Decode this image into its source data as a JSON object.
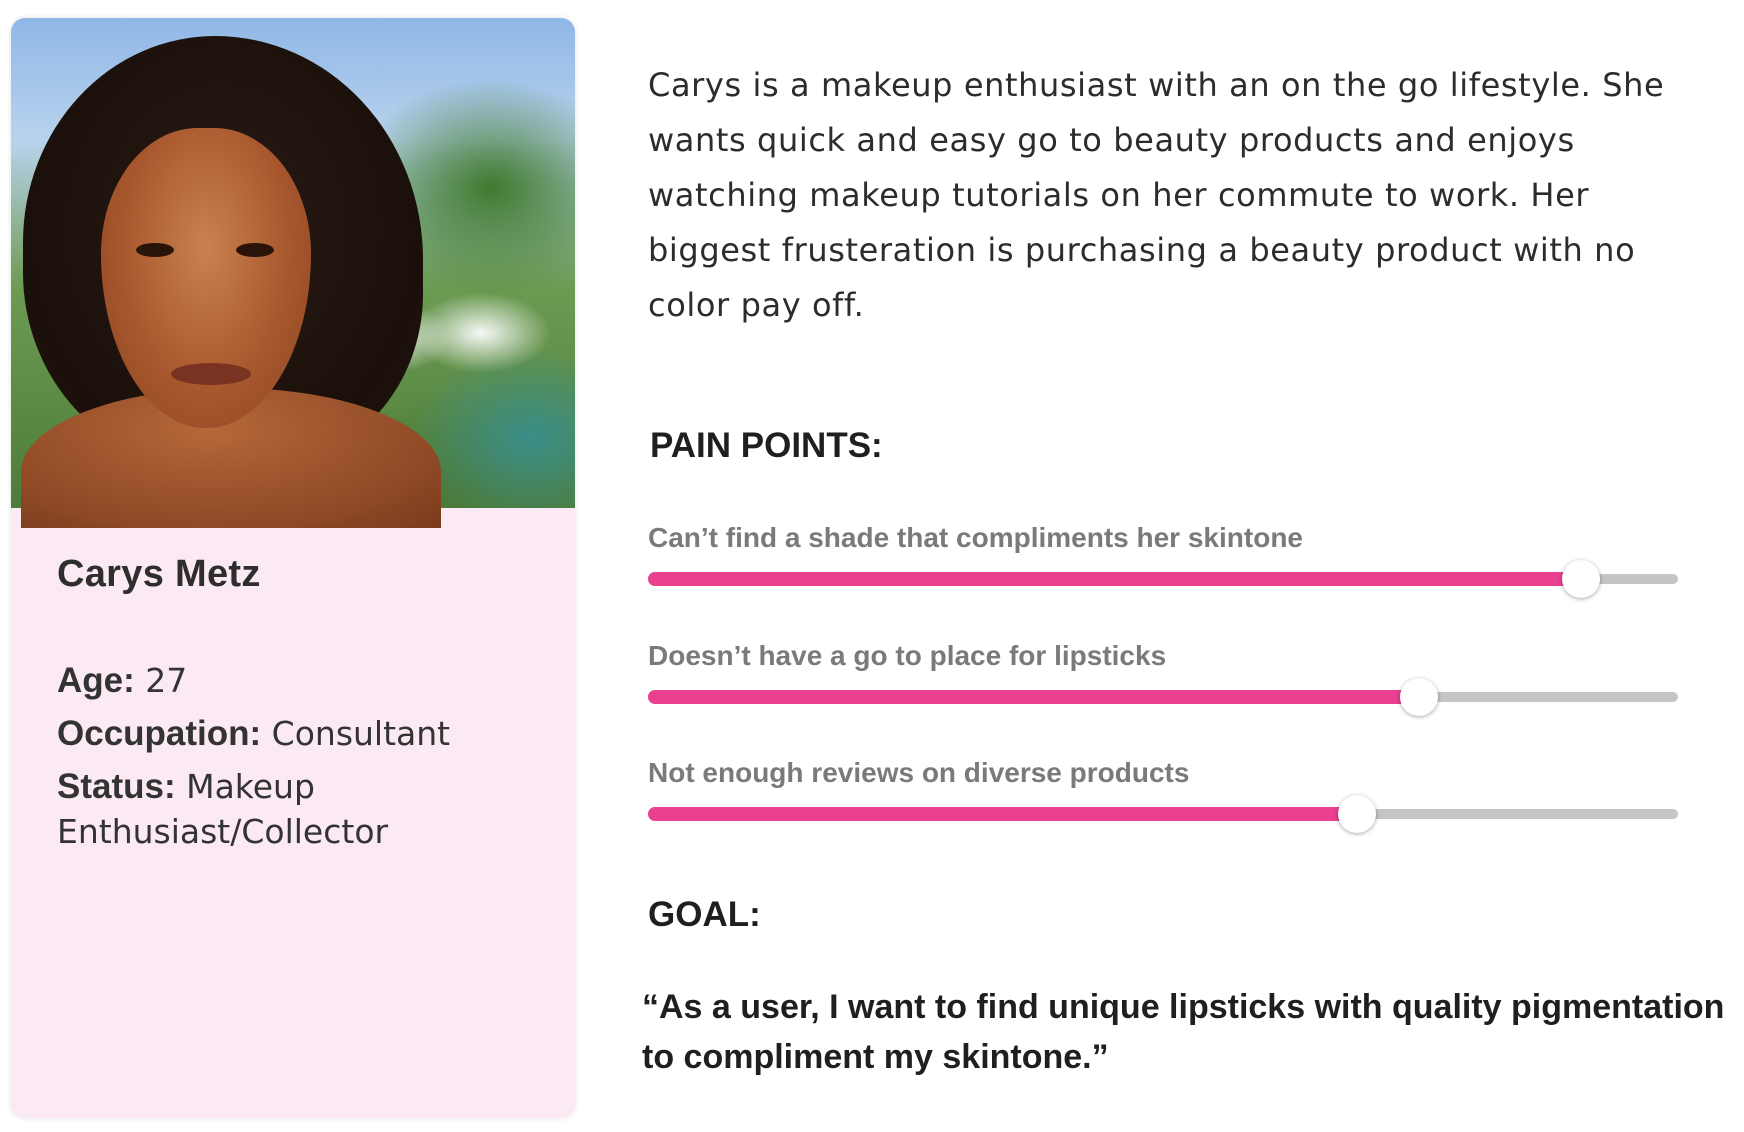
{
  "persona": {
    "name": "Carys Metz",
    "details": [
      {
        "label": "Age:",
        "value": " 27"
      },
      {
        "label": "Occupation:",
        "value": " Consultant"
      },
      {
        "label": "Status:",
        "value": " Makeup Enthusiast/Collector"
      }
    ]
  },
  "bio": "Carys is a makeup enthusiast with an on the go lifestyle. She wants quick and easy go to beauty products and enjoys watching makeup tutorials on her commute to work. Her biggest frusteration is purchasing a beauty product with no color pay off.",
  "pain_points": {
    "heading": "PAIN POINTS:",
    "items": [
      {
        "label": "Can’t find a shade that compliments her skintone",
        "level": 0.906
      },
      {
        "label": "Doesn’t have a go to place for lipsticks",
        "level": 0.749
      },
      {
        "label": "Not enough reviews on diverse products",
        "level": 0.688
      }
    ]
  },
  "goal": {
    "heading": "GOAL:",
    "quote": "“As a user, I want to find unique lipsticks with quality pigmentation to compliment my skintone.”"
  },
  "colors": {
    "card_background": "#fbeaf4",
    "slider_fill": "#e9408f",
    "slider_track": "#c3c5c6"
  }
}
